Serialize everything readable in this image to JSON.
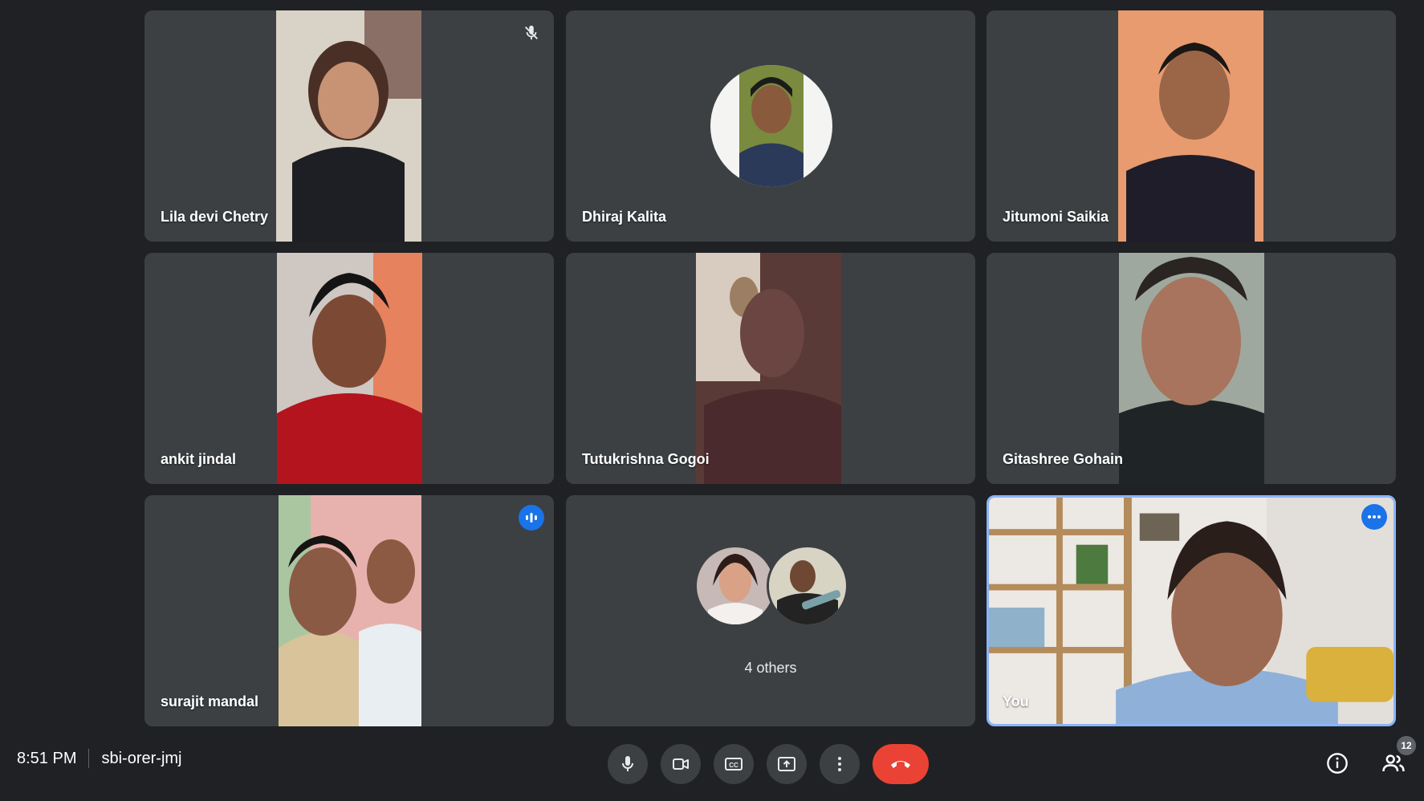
{
  "participants": [
    {
      "name": "Lila devi Chetry",
      "muted": true
    },
    {
      "name": "Dhiraj Kalita"
    },
    {
      "name": "Jitumoni Saikia"
    },
    {
      "name": "ankit jindal"
    },
    {
      "name": "Tutukrishna Gogoi"
    },
    {
      "name": "Gitashree Gohain"
    },
    {
      "name": "surajit mandal",
      "speaking": true
    },
    {
      "name": "4 others"
    },
    {
      "name": "You"
    }
  ],
  "meeting": {
    "time": "8:51 PM",
    "code": "sbi-orer-jmj"
  },
  "people_count": "12",
  "colors": {
    "background": "#202124",
    "tile": "#3c4043",
    "accent": "#1a73e8",
    "end_call": "#ea4335",
    "self_border": "#8ab4f8"
  },
  "controls": [
    "microphone-icon",
    "camera-icon",
    "captions-icon",
    "present-screen-icon",
    "more-options-icon",
    "end-call-icon"
  ],
  "right_tools": [
    "info-icon",
    "people-icon"
  ]
}
